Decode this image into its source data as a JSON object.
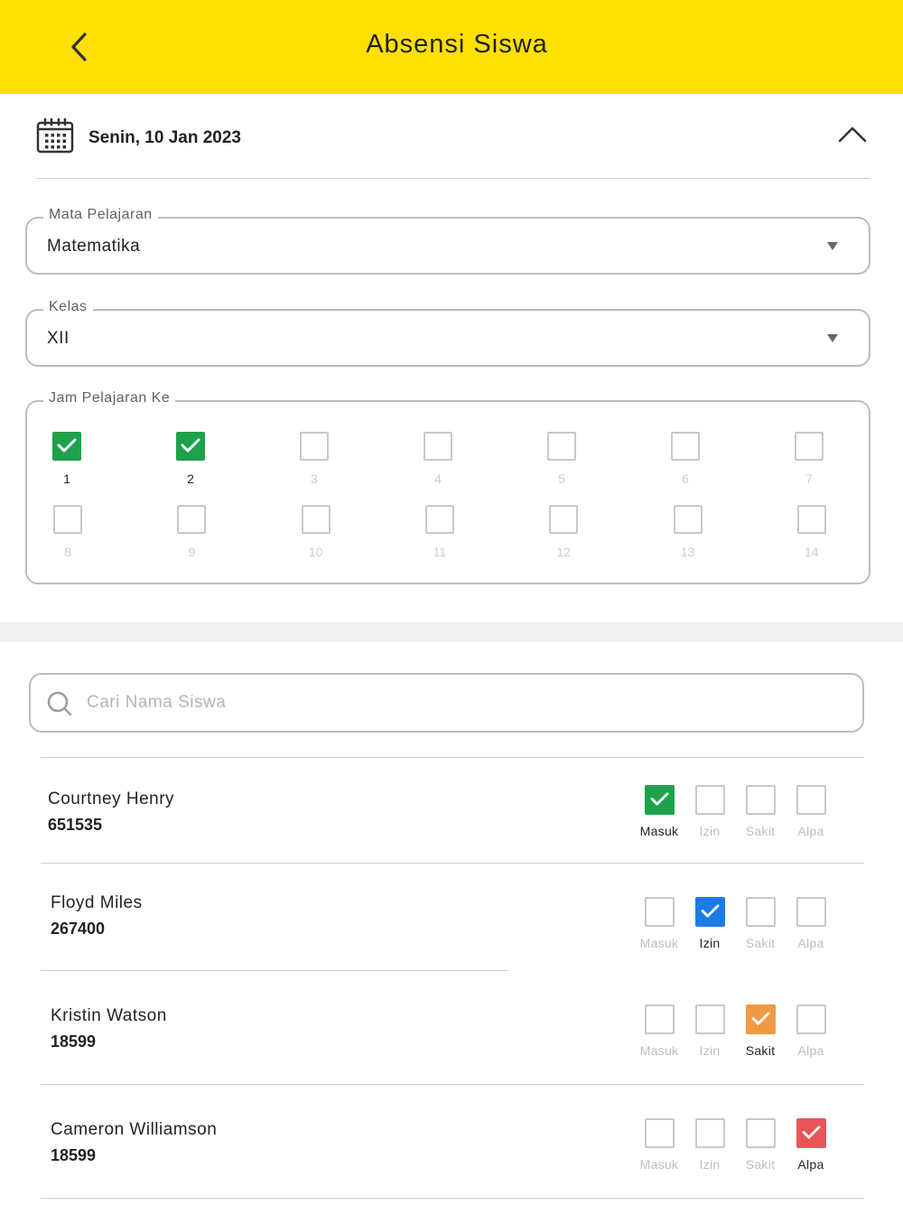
{
  "appbar": {
    "title": "Absensi Siswa"
  },
  "date": {
    "text": "Senin, 10 Jan 2023"
  },
  "fields": {
    "mapel": {
      "label": "Mata Pelajaran",
      "value": "Matematika"
    },
    "kelas": {
      "label": "Kelas",
      "value": "XII"
    }
  },
  "jam": {
    "label": "Jam Pelajaran Ke",
    "items": [
      {
        "n": "1",
        "checked": true
      },
      {
        "n": "2",
        "checked": true
      },
      {
        "n": "3",
        "checked": false
      },
      {
        "n": "4",
        "checked": false
      },
      {
        "n": "5",
        "checked": false
      },
      {
        "n": "6",
        "checked": false
      },
      {
        "n": "7",
        "checked": false
      },
      {
        "n": "8",
        "checked": false
      },
      {
        "n": "9",
        "checked": false
      },
      {
        "n": "10",
        "checked": false
      },
      {
        "n": "11",
        "checked": false
      },
      {
        "n": "12",
        "checked": false
      },
      {
        "n": "13",
        "checked": false
      },
      {
        "n": "14",
        "checked": false
      }
    ]
  },
  "search": {
    "placeholder": "Cari Nama Siswa"
  },
  "options": [
    "Masuk",
    "Izin",
    "Sakit",
    "Alpa"
  ],
  "students": [
    {
      "name": "Courtney Henry",
      "id": "651535",
      "status": "Masuk"
    },
    {
      "name": "Floyd Miles",
      "id": "267400",
      "status": "Izin"
    },
    {
      "name": "Kristin Watson",
      "id": "18599",
      "status": "Sakit"
    },
    {
      "name": "Cameron Williamson",
      "id": "18599",
      "status": "Alpa"
    }
  ],
  "colors": {
    "appbar": "#FFE000",
    "masuk": "#1FA14C",
    "izin": "#1E7BE6",
    "sakit": "#F19A45",
    "alpa": "#E8545A"
  }
}
